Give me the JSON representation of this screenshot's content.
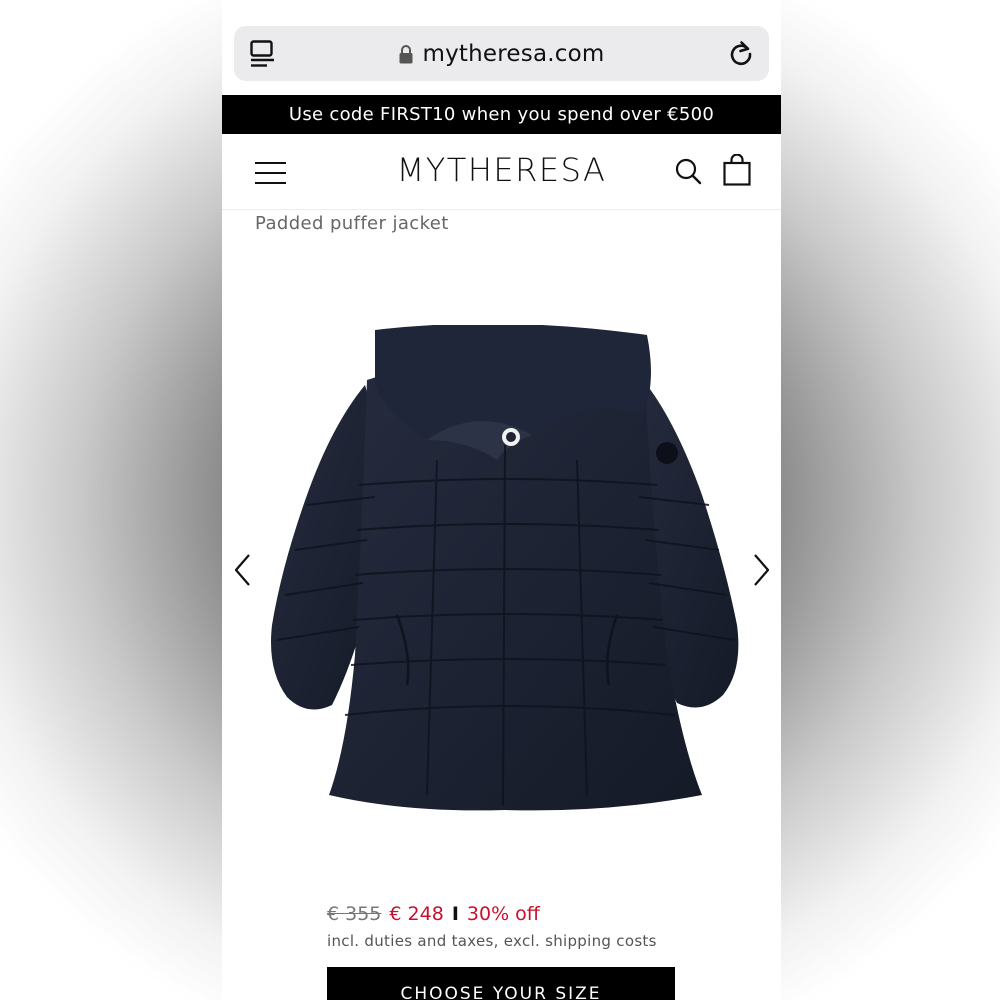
{
  "browser": {
    "url": "mytheresa.com"
  },
  "promo": {
    "text": "Use code FIRST10 when you spend over €500"
  },
  "header": {
    "logo": "MYTHERESA"
  },
  "product": {
    "title": "Padded puffer jacket",
    "price_original": "€ 355",
    "price_sale": "€ 248",
    "separator": "I",
    "discount": "30% off",
    "tax_note": "incl. duties and taxes, excl. shipping costs",
    "cta_label": "CHOOSE YOUR SIZE",
    "image": "navy-padded-puffer-jacket-photo"
  },
  "icons": {
    "tabs": "tabs-icon",
    "lock": "lock-icon",
    "reload": "reload-icon",
    "menu": "menu-icon",
    "search": "search-icon",
    "bag": "shopping-bag-icon",
    "prev": "chevron-left-icon",
    "next": "chevron-right-icon"
  },
  "colors": {
    "sale": "#c8102e",
    "banner": "#000000",
    "jacket": "#1d2333"
  }
}
